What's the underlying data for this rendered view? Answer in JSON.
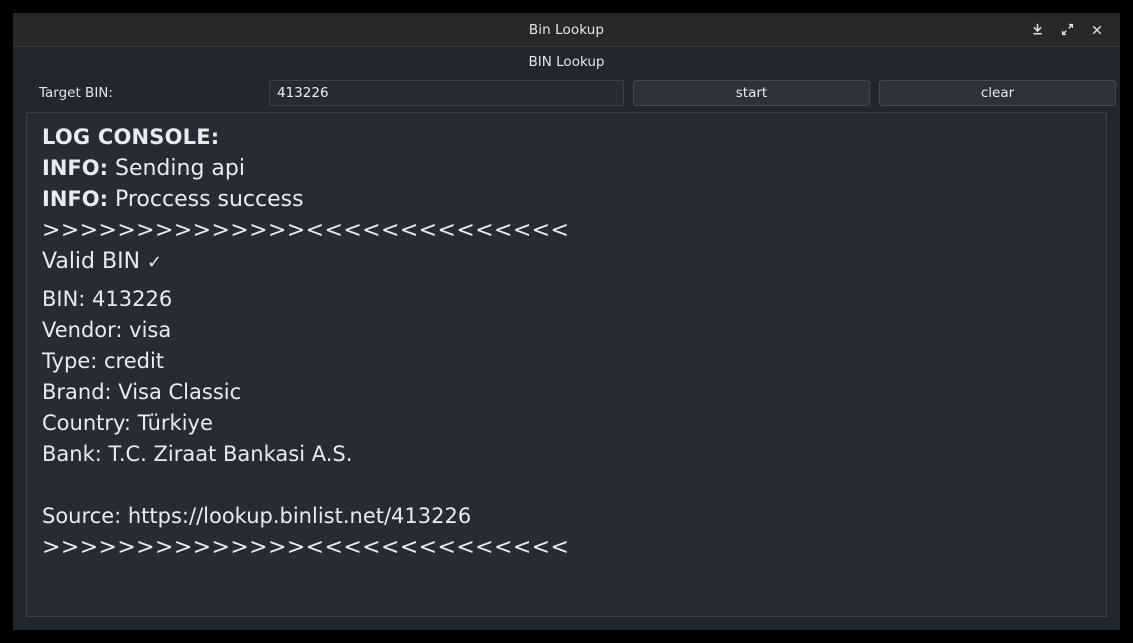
{
  "window": {
    "title": "Bin Lookup",
    "controls": [
      {
        "name": "download-icon",
        "label": "download"
      },
      {
        "name": "maximize-icon",
        "label": "maximize"
      },
      {
        "name": "close-icon",
        "label": "close"
      }
    ]
  },
  "header": {
    "title": "BIN Lookup"
  },
  "form": {
    "label": "Target BIN:",
    "input_value": "413226",
    "input_placeholder": "",
    "start_label": "start",
    "clear_label": "clear"
  },
  "console": {
    "title": "LOG CONSOLE:",
    "entries": [
      {
        "tag": "INFO:",
        "message": " Sending api"
      },
      {
        "tag": "INFO:",
        "message": " Proccess success"
      }
    ],
    "separator": ">>>>>>>>>>>>>><<<<<<<<<<<<<<",
    "validity": "Valid BIN ",
    "validity_icon": "✓",
    "details": [
      "BIN: 413226",
      "Vendor: visa",
      "Type: credit",
      "Brand: Visa Classic",
      "Country: Türkiye",
      "Bank: T.C. Ziraat Bankasi A.S."
    ],
    "source": "Source: https://lookup.binlist.net/413226",
    "separator_end": ">>>>>>>>>>>>>><<<<<<<<<<<<<<"
  },
  "colors": {
    "titlebar_bg": "#282828",
    "window_bg": "#22262e",
    "console_bg": "#272b36",
    "text": "#e9ebef",
    "button_bg": "#2c313c",
    "border": "#3b3f4a"
  }
}
